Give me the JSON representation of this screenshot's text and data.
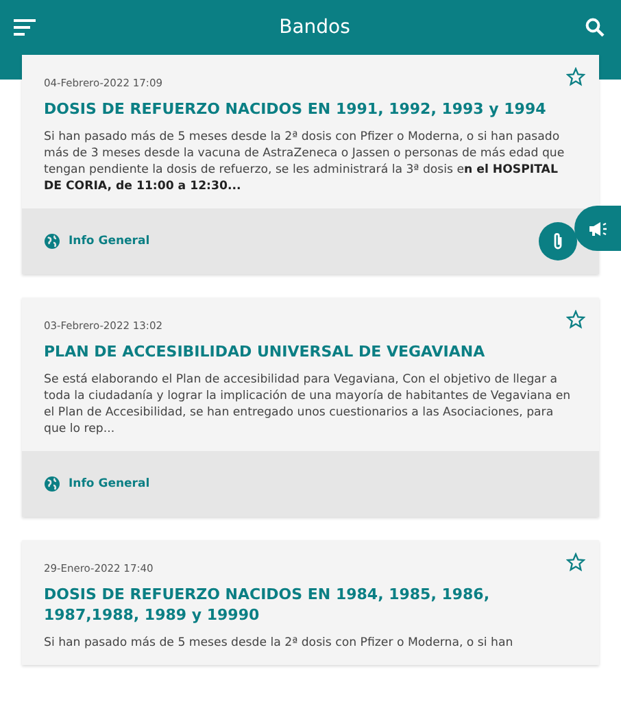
{
  "header": {
    "title": "Bandos"
  },
  "cards": [
    {
      "date": "04-Febrero-2022 17:09",
      "title": "DOSIS DE REFUERZO NACIDOS EN 1991, 1992, 1993 y 1994",
      "body": "Si han pasado más de 5 meses desde la 2ª dosis con Pfizer o Moderna, o si han pasado más de 3 meses desde la vacuna de AstraZeneca   o Jassen o personas de más edad que tengan pendiente la dosis de refuerzo, se les administrará la 3ª dosis e**n el HOSPITAL DE CORIA,  de 11:00 a 12:30...**",
      "category": "Info General",
      "starred": false,
      "attachment": true
    },
    {
      "date": "03-Febrero-2022 13:02",
      "title": "PLAN DE ACCESIBILIDAD UNIVERSAL DE VEGAVIANA",
      "body": "Se está elaborando el Plan de accesibilidad para Vegaviana,  Con el objetivo de llegar a toda la ciudadanía y lograr la implicación de una mayoría de habitantes de Vegaviana en el Plan de Accesibilidad,  se  han entregado unos cuestionarios a las Asociaciones, para que lo rep...",
      "category": "Info General",
      "starred": false,
      "attachment": false
    },
    {
      "date": "29-Enero-2022 17:40",
      "title": "DOSIS DE REFUERZO NACIDOS EN 1984, 1985, 1986, 1987,1988, 1989 y 19990",
      "body": "Si han pasado más de 5 meses desde la 2ª dosis con Pfizer o Moderna, o si han",
      "starred": false,
      "attachment": false
    }
  ]
}
